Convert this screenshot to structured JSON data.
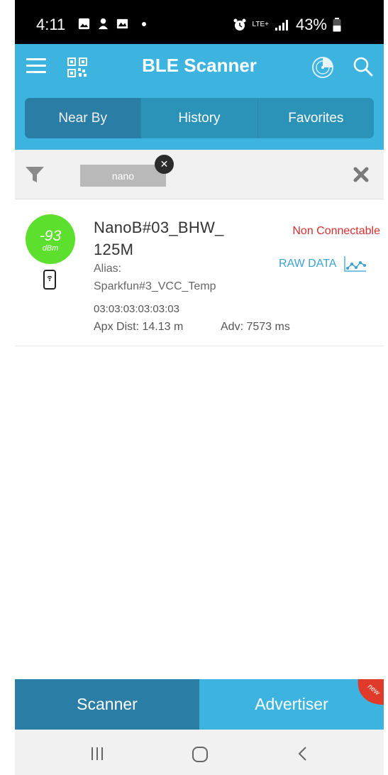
{
  "status_bar": {
    "time": "4:11",
    "network": "LTE+",
    "battery": "43%"
  },
  "app_bar": {
    "title": "BLE Scanner"
  },
  "tabs": [
    {
      "label": "Near By",
      "active": true
    },
    {
      "label": "History",
      "active": false
    },
    {
      "label": "Favorites",
      "active": false
    }
  ],
  "filter": {
    "chip_label": "nano"
  },
  "devices": [
    {
      "rssi": "-93",
      "rssi_unit": "dBm",
      "name": "NanoB#03_BHW_ 125M",
      "alias_label": "Alias:",
      "alias": "Sparkfun#3_VCC_Temp",
      "mac": "03:03:03:03:03:03",
      "distance": "Apx Dist: 14.13 m",
      "adv": "Adv: 7573 ms",
      "connectable": "Non Connectable",
      "raw_data_label": "RAW DATA"
    }
  ],
  "bottom_tabs": {
    "scanner": "Scanner",
    "advertiser": "Advertiser",
    "badge": "new"
  },
  "colors": {
    "primary": "#3db4e0",
    "primary_dark": "#2a7ea6",
    "rssi_green": "#5de02d",
    "non_connectable": "#d62f2f",
    "raw_data": "#3aa3d6"
  }
}
